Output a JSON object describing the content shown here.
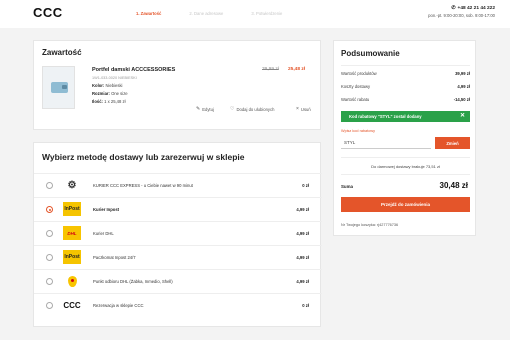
{
  "header": {
    "logo": "CCC",
    "steps": [
      "1. Zawartość",
      "2. Dane adresowe",
      "3. Potwierdzenie"
    ],
    "phone": "+48 42 21 44 222",
    "hours": "pon.-pt. 9:00-20:00, sob. 9:00-17:00"
  },
  "basket": {
    "title": "Zawartość",
    "product": {
      "name": "Portfel damski ACCCESSORIES",
      "code": "1W1-033-0020 NIEBIESKI",
      "color_label": "Kolor:",
      "color_value": "Niebieski",
      "size_label": "Rozmiar:",
      "size_value": "One size",
      "qty_label": "Ilość:",
      "qty_value": "1 x 25,48 zł",
      "old_price": "39,99 zł",
      "new_price": "25,48 zł"
    },
    "actions": {
      "edit": "Edytuj",
      "favorite": "Dodaj do ulubionych",
      "remove": "Usuń"
    }
  },
  "delivery": {
    "title": "Wybierz metodę dostawy lub zarezerwuj w sklepie",
    "options": [
      {
        "name": "KURIER CCC EXPRESS - u Ciebie nawet w 90 minut",
        "price": "0 zł",
        "logo": "express-icon",
        "selected": false,
        "bold": false
      },
      {
        "name": "Kurier Inpost",
        "price": "4,99 zł",
        "logo": "inpost",
        "selected": true,
        "bold": true
      },
      {
        "name": "Kurier DHL",
        "price": "4,99 zł",
        "logo": "dhl",
        "selected": false,
        "bold": false
      },
      {
        "name": "Paczkomat Inpost 24/7",
        "price": "4,99 zł",
        "logo": "inpost",
        "selected": false,
        "bold": false
      },
      {
        "name": "Punkt odbioru DHL (Żabka, Inmedio, Shell)",
        "price": "4,99 zł",
        "logo": "dhl-pin",
        "selected": false,
        "bold": false
      },
      {
        "name": "Rezerwacja w sklepie CCC",
        "price": "0 zł",
        "logo": "ccc",
        "selected": false,
        "bold": false
      }
    ],
    "logo_text": {
      "inpost": "InPost",
      "dhl": "DHL",
      "ccc": "CCC",
      "express": "⚙"
    }
  },
  "summary": {
    "title": "Podsumowanie",
    "products_label": "Wartość produktów",
    "products_value": "39,99 zł",
    "shipping_label": "Koszty dostawy",
    "shipping_value": "4,99 zł",
    "discount_label": "Wartość rabatu",
    "discount_value": "-14,50 zł",
    "promo_message": "Kod rabatowy \"STYL\" został dodany",
    "code_label": "Wpisz kod rabatowy",
    "code_value": "STYL",
    "code_button": "Zmień",
    "free_shipping": "Do darmowej dostawy brakuje 73,51 zł",
    "sum_label": "Suma",
    "sum_value": "30,48 zł",
    "checkout_button": "Przejdź do zamówienia",
    "basket_number": "Nr Twojego koszyka: rj427776736"
  },
  "colors": {
    "accent": "#e4552a",
    "success": "#2aa149",
    "inpost": "#f5c400",
    "dhl_red": "#d40511"
  }
}
